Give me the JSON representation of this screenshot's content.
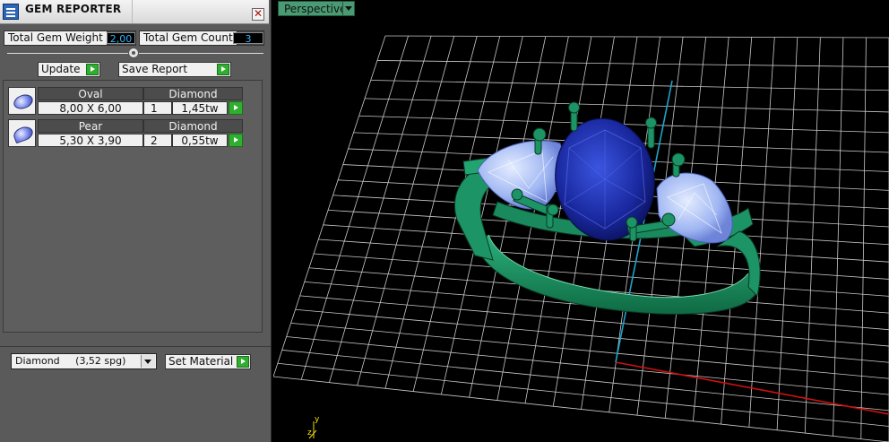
{
  "panel": {
    "title": "GEM REPORTER",
    "close_glyph": "✕",
    "stats": {
      "total_weight_label": "Total Gem Weight",
      "total_weight_value": "2,00",
      "total_count_label": "Total Gem Count",
      "total_count_value": "3"
    },
    "buttons": {
      "update": "Update",
      "save_report": "Save Report",
      "set_material": "Set Material"
    },
    "gems": [
      {
        "shape": "Oval",
        "material": "Diamond",
        "size": "8,00 X 6,00",
        "count": "1",
        "weight": "1,45tw"
      },
      {
        "shape": "Pear",
        "material": "Diamond",
        "size": "5,30 X 3,90",
        "count": "2",
        "weight": "0,55tw"
      }
    ],
    "material_select": {
      "value": "Diamond     (3,52 spg)"
    }
  },
  "viewport": {
    "view_label": "Perspective",
    "axis_labels": {
      "y": "y",
      "z": "z"
    }
  },
  "colors": {
    "accent_green": "#2fae2f",
    "stat_value": "#33b5ff",
    "grid": "#c8c8c8",
    "ring": "#1b8f5f",
    "center_stone": "#1f2fa8",
    "side_stones": "#9fb8f4",
    "x_axis": "#d01010",
    "z_axis": "#1fa3c8"
  },
  "icons": [
    "app-icon",
    "close-icon",
    "play-arrow-icon",
    "gem-thumbnail-icon",
    "dropdown-arrow-icon",
    "axis-gizmo-icon"
  ]
}
